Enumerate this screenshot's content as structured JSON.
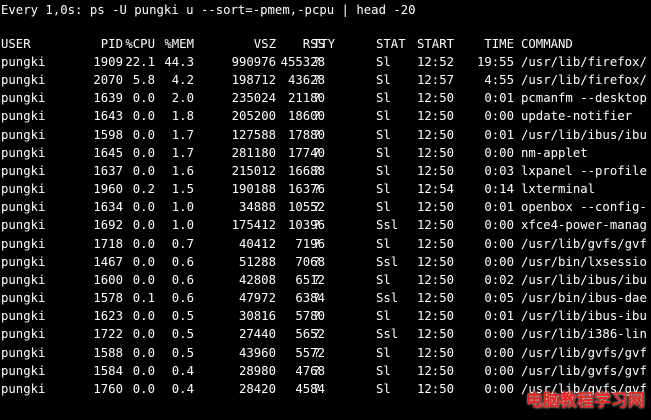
{
  "terminal": {
    "header": "Every 1,0s: ps -U pungki u --sort=-pmem,-pcpu | head -20",
    "columns": {
      "user": "USER",
      "pid": "PID",
      "cpu": "%CPU",
      "mem": "%MEM",
      "vsz": "VSZ",
      "rss": "RSS",
      "tty": "TTY",
      "stat": "STAT",
      "start": "START",
      "time": "TIME",
      "command": "COMMAND"
    },
    "rows": [
      {
        "user": "pungki",
        "pid": "1909",
        "cpu": "22.1",
        "mem": "44.3",
        "vsz": "990976",
        "rss": "455328",
        "tty": "?",
        "stat": "Sl",
        "start": "12:52",
        "time": "19:55",
        "command": "/usr/lib/firefox/"
      },
      {
        "user": "pungki",
        "pid": "2070",
        "cpu": "5.8",
        "mem": "4.2",
        "vsz": "198712",
        "rss": "43628",
        "tty": "?",
        "stat": "Sl",
        "start": "12:57",
        "time": "4:55",
        "command": "/usr/lib/firefox/"
      },
      {
        "user": "pungki",
        "pid": "1639",
        "cpu": "0.0",
        "mem": "2.0",
        "vsz": "235024",
        "rss": "21180",
        "tty": "?",
        "stat": "Sl",
        "start": "12:50",
        "time": "0:01",
        "command": "pcmanfm --desktop"
      },
      {
        "user": "pungki",
        "pid": "1643",
        "cpu": "0.0",
        "mem": "1.8",
        "vsz": "205200",
        "rss": "18600",
        "tty": "?",
        "stat": "Sl",
        "start": "12:50",
        "time": "0:00",
        "command": "update-notifier"
      },
      {
        "user": "pungki",
        "pid": "1598",
        "cpu": "0.0",
        "mem": "1.7",
        "vsz": "127588",
        "rss": "17880",
        "tty": "?",
        "stat": "Sl",
        "start": "12:50",
        "time": "0:01",
        "command": "/usr/lib/ibus/ibu"
      },
      {
        "user": "pungki",
        "pid": "1645",
        "cpu": "0.0",
        "mem": "1.7",
        "vsz": "281180",
        "rss": "17740",
        "tty": "?",
        "stat": "Sl",
        "start": "12:50",
        "time": "0:00",
        "command": "nm-applet"
      },
      {
        "user": "pungki",
        "pid": "1637",
        "cpu": "0.0",
        "mem": "1.6",
        "vsz": "215012",
        "rss": "16688",
        "tty": "?",
        "stat": "Sl",
        "start": "12:50",
        "time": "0:03",
        "command": "lxpanel --profile"
      },
      {
        "user": "pungki",
        "pid": "1960",
        "cpu": "0.2",
        "mem": "1.5",
        "vsz": "190188",
        "rss": "16376",
        "tty": "?",
        "stat": "Sl",
        "start": "12:54",
        "time": "0:14",
        "command": "lxterminal"
      },
      {
        "user": "pungki",
        "pid": "1634",
        "cpu": "0.0",
        "mem": "1.0",
        "vsz": "34888",
        "rss": "10552",
        "tty": "?",
        "stat": "Sl",
        "start": "12:50",
        "time": "0:01",
        "command": "openbox --config-"
      },
      {
        "user": "pungki",
        "pid": "1692",
        "cpu": "0.0",
        "mem": "1.0",
        "vsz": "175412",
        "rss": "10396",
        "tty": "?",
        "stat": "Ssl",
        "start": "12:50",
        "time": "0:00",
        "command": "xfce4-power-manag"
      },
      {
        "user": "pungki",
        "pid": "1718",
        "cpu": "0.0",
        "mem": "0.7",
        "vsz": "40412",
        "rss": "7196",
        "tty": "?",
        "stat": "Sl",
        "start": "12:50",
        "time": "0:00",
        "command": "/usr/lib/gvfs/gvf"
      },
      {
        "user": "pungki",
        "pid": "1467",
        "cpu": "0.0",
        "mem": "0.6",
        "vsz": "51288",
        "rss": "7068",
        "tty": "?",
        "stat": "Ssl",
        "start": "12:50",
        "time": "0:00",
        "command": "/usr/bin/lxsessio"
      },
      {
        "user": "pungki",
        "pid": "1600",
        "cpu": "0.0",
        "mem": "0.6",
        "vsz": "42808",
        "rss": "6512",
        "tty": "?",
        "stat": "Sl",
        "start": "12:50",
        "time": "0:02",
        "command": "/usr/lib/ibus/ibu"
      },
      {
        "user": "pungki",
        "pid": "1578",
        "cpu": "0.1",
        "mem": "0.6",
        "vsz": "47972",
        "rss": "6384",
        "tty": "?",
        "stat": "Ssl",
        "start": "12:50",
        "time": "0:05",
        "command": "/usr/bin/ibus-dae"
      },
      {
        "user": "pungki",
        "pid": "1623",
        "cpu": "0.0",
        "mem": "0.5",
        "vsz": "30816",
        "rss": "5780",
        "tty": "?",
        "stat": "Sl",
        "start": "12:50",
        "time": "0:01",
        "command": "/usr/lib/ibus-ibu"
      },
      {
        "user": "pungki",
        "pid": "1722",
        "cpu": "0.0",
        "mem": "0.5",
        "vsz": "27440",
        "rss": "5652",
        "tty": "?",
        "stat": "Ssl",
        "start": "12:50",
        "time": "0:00",
        "command": "/usr/lib/i386-lin"
      },
      {
        "user": "pungki",
        "pid": "1588",
        "cpu": "0.0",
        "mem": "0.5",
        "vsz": "43960",
        "rss": "5572",
        "tty": "?",
        "stat": "Sl",
        "start": "12:50",
        "time": "0:00",
        "command": "/usr/lib/gvfs/gvf"
      },
      {
        "user": "pungki",
        "pid": "1584",
        "cpu": "0.0",
        "mem": "0.4",
        "vsz": "28980",
        "rss": "4768",
        "tty": "?",
        "stat": "Sl",
        "start": "12:50",
        "time": "0:00",
        "command": "/usr/lib/gvfs/gvf"
      },
      {
        "user": "pungki",
        "pid": "1760",
        "cpu": "0.0",
        "mem": "0.4",
        "vsz": "28420",
        "rss": "4584",
        "tty": "?",
        "stat": "Sl",
        "start": "12:50",
        "time": "0:00",
        "command": "/usr/lib/gvfs/gvf"
      }
    ]
  },
  "watermark": "电脑教程学习网",
  "colors": {
    "background": "#000000",
    "text": "#ffffff",
    "watermark": "#e8231d"
  }
}
